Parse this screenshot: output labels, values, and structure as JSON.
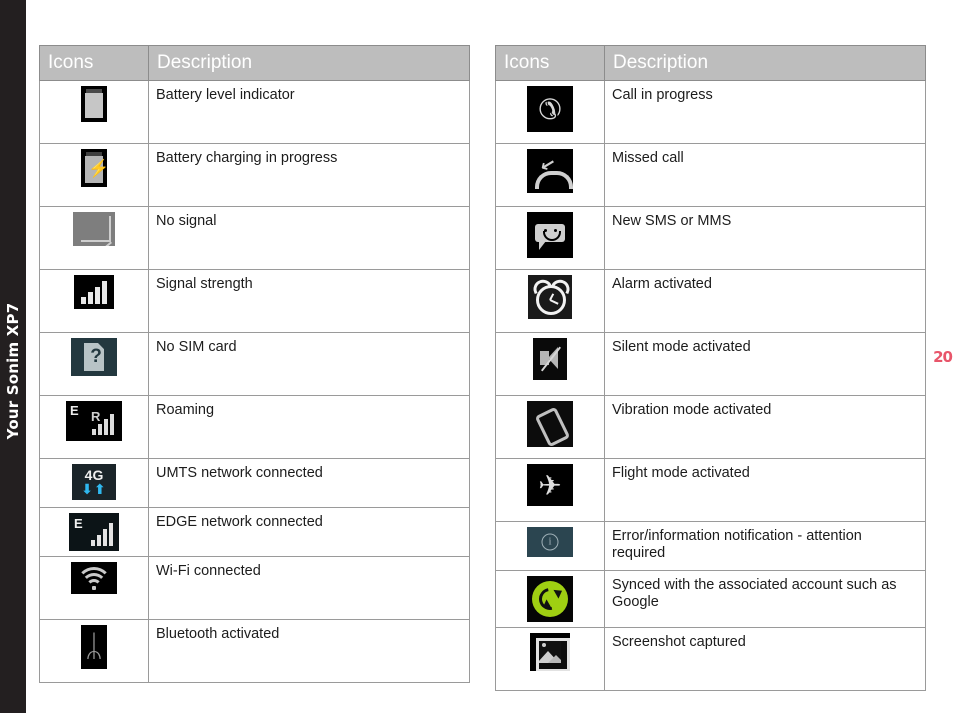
{
  "sidebar": {
    "running_head": "Your Sonim XP7"
  },
  "page_number": "20",
  "colors": {
    "sidebar_bg": "#231f20",
    "header_bg": "#bdbdbd",
    "header_text": "#ffffff",
    "border": "#9a9a9a",
    "page_number": "#e8556a",
    "sync_green": "#9fcf12",
    "info_teal": "#2b4550",
    "data_blue": "#2fb8ef"
  },
  "tables": [
    {
      "id": "table-left",
      "headers": {
        "icons": "Icons",
        "description": "Description"
      },
      "rows": [
        {
          "icon": "battery-level-icon",
          "description": "Battery level indicator"
        },
        {
          "icon": "battery-charging-icon",
          "description": "Battery charging in progress"
        },
        {
          "icon": "no-signal-icon",
          "description": "No signal"
        },
        {
          "icon": "signal-strength-icon",
          "description": "Signal strength"
        },
        {
          "icon": "no-sim-card-icon",
          "description": "No SIM card"
        },
        {
          "icon": "roaming-icon",
          "description": "Roaming"
        },
        {
          "icon": "umts-4g-network-icon",
          "description": "UMTS network connected"
        },
        {
          "icon": "edge-network-icon",
          "description": "EDGE network connected"
        },
        {
          "icon": "wifi-connected-icon",
          "description": "Wi-Fi connected"
        },
        {
          "icon": "bluetooth-activated-icon",
          "description": "Bluetooth activated"
        }
      ]
    },
    {
      "id": "table-right",
      "headers": {
        "icons": "Icons",
        "description": "Description"
      },
      "rows": [
        {
          "icon": "call-in-progress-icon",
          "description": "Call in progress"
        },
        {
          "icon": "missed-call-icon",
          "description": "Missed call"
        },
        {
          "icon": "new-sms-mms-icon",
          "description": "New SMS or MMS"
        },
        {
          "icon": "alarm-activated-icon",
          "description": "Alarm activated"
        },
        {
          "icon": "silent-mode-icon",
          "description": "Silent mode activated"
        },
        {
          "icon": "vibration-mode-icon",
          "description": "Vibration mode activated"
        },
        {
          "icon": "flight-mode-icon",
          "description": "Flight mode activated"
        },
        {
          "icon": "error-information-icon",
          "description": "Error/information notification -  attention required"
        },
        {
          "icon": "sync-account-icon",
          "description": "Synced with the associated account such as Google"
        },
        {
          "icon": "screenshot-captured-icon",
          "description": "Screenshot captured"
        }
      ]
    }
  ],
  "icon_glyphs": {
    "umts_label": "4G",
    "umts_arrows": "⬇⬆",
    "roaming_e": "E",
    "roaming_r": "R",
    "edge_e": "E",
    "no_sim_mark": "?",
    "bluetooth_sym": "ᛦ",
    "call_sym": "✆",
    "flight_sym": "✈",
    "missed_arrow": "↙",
    "info_mark": "i"
  }
}
